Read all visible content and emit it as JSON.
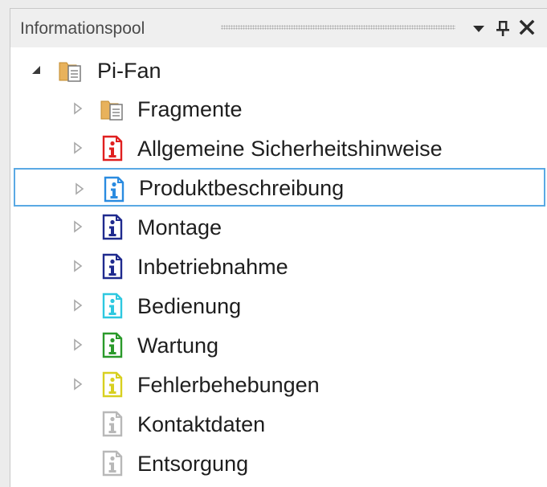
{
  "panel": {
    "title": "Informationspool",
    "buttons": {
      "dropdown": "dropdown-arrow-icon",
      "pin": "pin-icon",
      "close": "close-icon"
    }
  },
  "tree": {
    "root": {
      "label": "Pi-Fan",
      "icon": "folder-document-icon",
      "expanded": true
    },
    "items": [
      {
        "label": "Fragmente",
        "icon": "folder-document-icon",
        "color": "#d9a34a",
        "has_children": true,
        "selected": false
      },
      {
        "label": "Allgemeine Sicherheitshinweise",
        "icon": "info-red-icon",
        "color": "#e02020",
        "has_children": true,
        "selected": false
      },
      {
        "label": "Produktbeschreibung",
        "icon": "info-blue-icon",
        "color": "#2a8be0",
        "has_children": true,
        "selected": true
      },
      {
        "label": "Montage",
        "icon": "info-navy-icon",
        "color": "#1f2a8e",
        "has_children": true,
        "selected": false
      },
      {
        "label": "Inbetriebnahme",
        "icon": "info-navy-icon",
        "color": "#1f2a8e",
        "has_children": true,
        "selected": false
      },
      {
        "label": "Bedienung",
        "icon": "info-cyan-icon",
        "color": "#2ec8e0",
        "has_children": true,
        "selected": false
      },
      {
        "label": "Wartung",
        "icon": "info-green-icon",
        "color": "#2a9a2a",
        "has_children": true,
        "selected": false
      },
      {
        "label": "Fehlerbehebungen",
        "icon": "info-yellow-icon",
        "color": "#d8d020",
        "has_children": true,
        "selected": false
      },
      {
        "label": "Kontaktdaten",
        "icon": "info-gray-icon",
        "color": "#b8b8b8",
        "has_children": false,
        "selected": false
      },
      {
        "label": "Entsorgung",
        "icon": "info-gray-icon",
        "color": "#b8b8b8",
        "has_children": false,
        "selected": false
      }
    ]
  }
}
